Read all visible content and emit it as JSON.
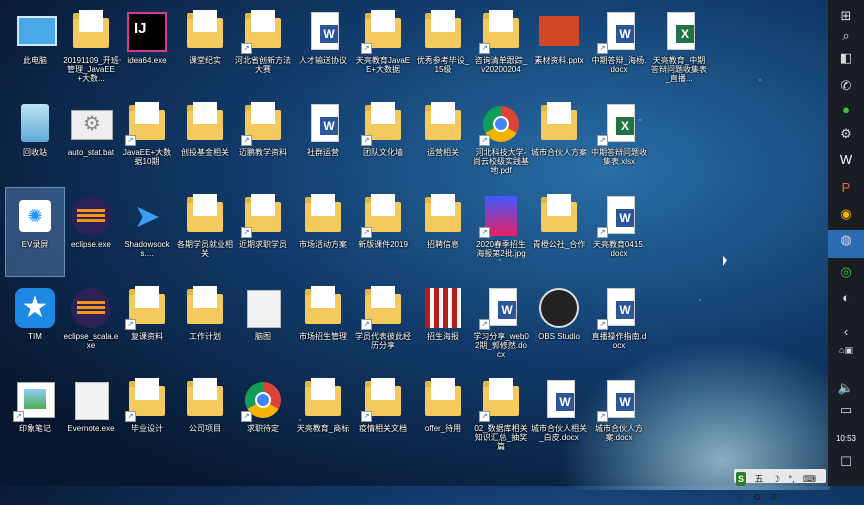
{
  "desktop": {
    "icons": [
      {
        "label": "此电脑",
        "kind": "pc"
      },
      {
        "label": "20191109_开班管理_JavaEE+大数...",
        "kind": "folder"
      },
      {
        "label": "idea64.exe",
        "kind": "ij"
      },
      {
        "label": "课堂纪实",
        "kind": "folder"
      },
      {
        "label": "河北省创新方法大赛",
        "kind": "folder"
      },
      {
        "label": "人才输送协议",
        "kind": "word"
      },
      {
        "label": "天亮教育JavaEE+大数据",
        "kind": "folder"
      },
      {
        "label": "优秀参考毕设_15级",
        "kind": "folder"
      },
      {
        "label": "咨询清单跟踪_v20200204",
        "kind": "folder"
      },
      {
        "label": "素材资料.pptx",
        "kind": "ppt"
      },
      {
        "label": "中期答辩_海杨.docx",
        "kind": "word"
      },
      {
        "label": "天亮教育_中期答辩问题收集表_直播...",
        "kind": "excel"
      },
      {
        "label": "回收站",
        "kind": "bin"
      },
      {
        "label": "auto_stat.bat",
        "kind": "gear"
      },
      {
        "label": "JavaEE+大数据10期",
        "kind": "folder"
      },
      {
        "label": "创投基金相关",
        "kind": "folder"
      },
      {
        "label": "迈鹏教学资料",
        "kind": "folder"
      },
      {
        "label": "社群运营",
        "kind": "word"
      },
      {
        "label": "团队文化墙",
        "kind": "folder"
      },
      {
        "label": "运营相关",
        "kind": "folder"
      },
      {
        "label": "河北科技大学-尚云校级实践基地.pdf",
        "kind": "chrome"
      },
      {
        "label": "城市合伙人方案",
        "kind": "folder"
      },
      {
        "label": "中期答辩问题收集表.xlsx",
        "kind": "excel"
      },
      {
        "label": "EV录屏",
        "kind": "ev"
      },
      {
        "label": "eclipse.exe",
        "kind": "eclipse"
      },
      {
        "label": "Shadowsocks....",
        "kind": "ss"
      },
      {
        "label": "各期学员就业相关",
        "kind": "folder"
      },
      {
        "label": "近期求职学员",
        "kind": "folder"
      },
      {
        "label": "市场活动方案",
        "kind": "folder"
      },
      {
        "label": "新版课件2019",
        "kind": "folder"
      },
      {
        "label": "招聘信息",
        "kind": "folder"
      },
      {
        "label": "2020春季招生海报第2批.jpg",
        "kind": "poster"
      },
      {
        "label": "青橙公社_合作",
        "kind": "folder"
      },
      {
        "label": "天亮教育0415.docx",
        "kind": "word"
      },
      {
        "label": "TIM",
        "kind": "tim"
      },
      {
        "label": "eclipse_scala.exe",
        "kind": "eclipse"
      },
      {
        "label": "复课资料",
        "kind": "folder"
      },
      {
        "label": "工作计划",
        "kind": "folder"
      },
      {
        "label": "脑图",
        "kind": "white"
      },
      {
        "label": "市场招生管理",
        "kind": "folder"
      },
      {
        "label": "学员代表彼此经历分享",
        "kind": "folder"
      },
      {
        "label": "招生海报",
        "kind": "bookcase"
      },
      {
        "label": "学习分享_web02期_郭修然.docx",
        "kind": "word"
      },
      {
        "label": "OBS Studio",
        "kind": "obs"
      },
      {
        "label": "直播操作指南.docx",
        "kind": "word"
      },
      {
        "label": "印象笔记",
        "kind": "pic"
      },
      {
        "label": "Evernote.exe",
        "kind": "white"
      },
      {
        "label": "毕业设计",
        "kind": "folder"
      },
      {
        "label": "公司项目",
        "kind": "folder"
      },
      {
        "label": "求职待定",
        "kind": "chrome"
      },
      {
        "label": "天亮教育_商标",
        "kind": "folder"
      },
      {
        "label": "疫情相关文档",
        "kind": "folder"
      },
      {
        "label": "offer_待用",
        "kind": "folder"
      },
      {
        "label": "02_数据库相关知识汇总_抽奖篇",
        "kind": "folder"
      },
      {
        "label": "城市合伙人相关_白皮.docx",
        "kind": "word"
      },
      {
        "label": "城市合伙人方案.docx",
        "kind": "word"
      }
    ]
  },
  "taskbar": {
    "items": [
      "search-icon",
      "view-icon",
      "phone-icon",
      "wechat-icon",
      "gear-icon",
      "word-icon",
      "ppt-icon",
      "chrome-icon",
      "green-app-icon",
      "360-icon",
      "app-icon"
    ],
    "clock": "10:53"
  },
  "ime": {
    "logo": "S",
    "mode": "五",
    "items": [
      "☽",
      "°,",
      "⌨",
      "☺",
      "✿",
      "⚙"
    ]
  }
}
